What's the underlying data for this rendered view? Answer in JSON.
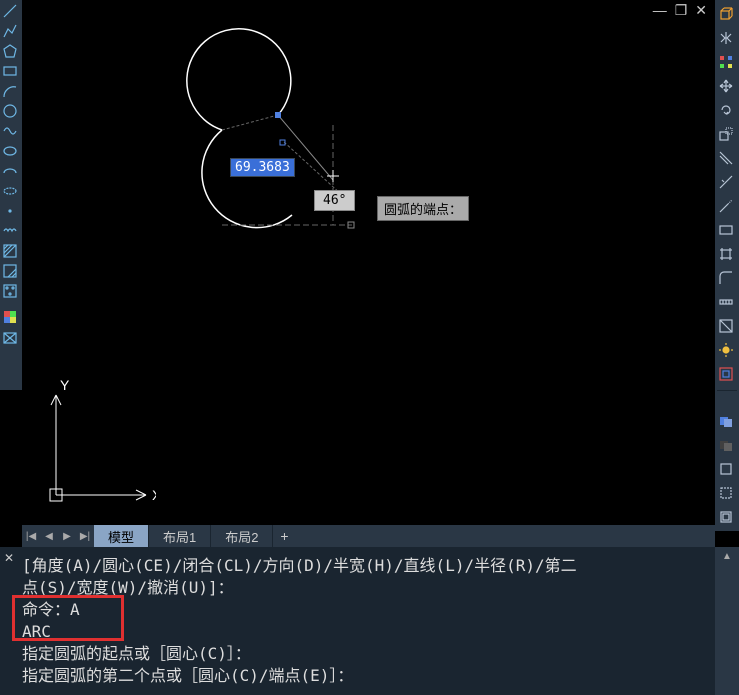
{
  "window": {
    "minimize": "—",
    "maximize": "❐",
    "close": "✕"
  },
  "left_tools": [
    "line",
    "polyline",
    "circle",
    "arc",
    "rectangle",
    "ellipse",
    "spline",
    "wave",
    "ellipse-arc",
    "arc2",
    "cloud",
    "point",
    "cloud2",
    "hatch",
    "hatch2",
    "grid",
    "color",
    "origin"
  ],
  "right_tools_top": [
    "cube",
    "mirror",
    "squares",
    "move",
    "rotate",
    "rect",
    "ortho",
    "tangent",
    "snap",
    "fence",
    "stretch",
    "measure",
    "edit",
    "fill",
    "sun",
    "group"
  ],
  "right_tools_bottom": [
    "layer1",
    "layer2",
    "box",
    "dash",
    "box2"
  ],
  "drawing": {
    "distance_value": "69.3683",
    "angle_value": "46°",
    "tooltip": "圆弧的端点："
  },
  "ucs": {
    "x": "X",
    "y": "Y"
  },
  "tabs": {
    "model": "模型",
    "layout1": "布局1",
    "layout2": "布局2",
    "add": "+"
  },
  "cmd": {
    "line1": "[角度(A)/圆心(CE)/闭合(CL)/方向(D)/半宽(H)/直线(L)/半径(R)/第二",
    "line2": "点(S)/宽度(W)/撤消(U)]：",
    "line3": "命令：A",
    "line4": "ARC",
    "line5": "指定圆弧的起点或［圆心(C)］：",
    "line6": "指定圆弧的第二个点或［圆心(C)/端点(E)］："
  }
}
